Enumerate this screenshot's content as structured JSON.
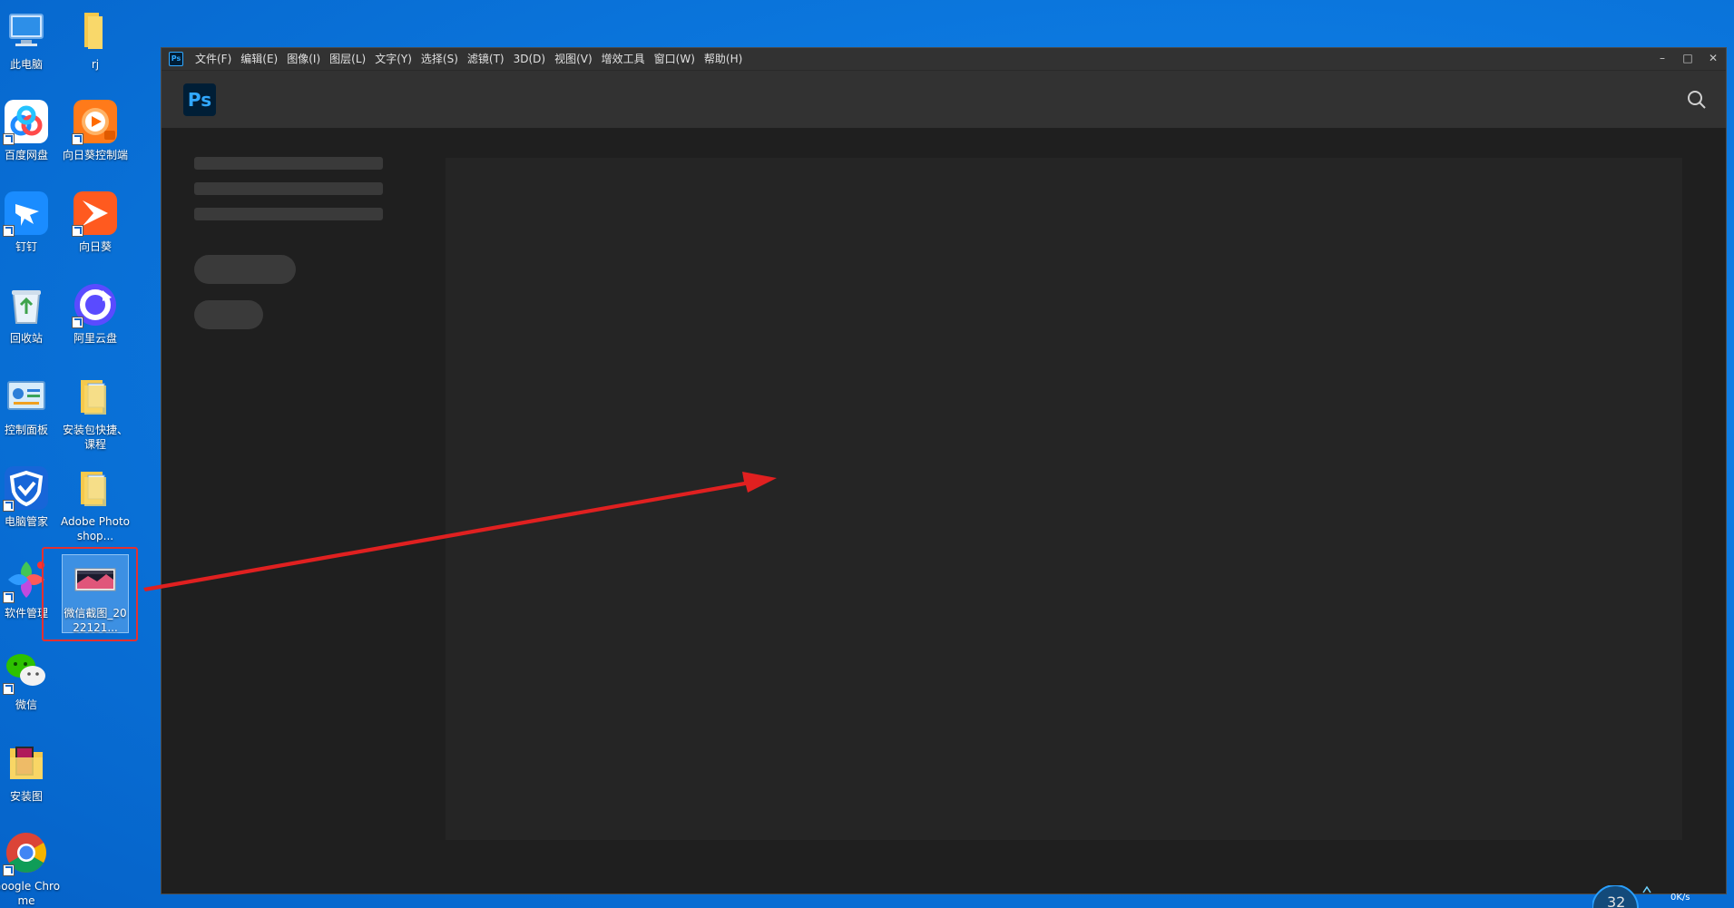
{
  "desktop": {
    "icons": [
      {
        "label": "此电脑"
      },
      {
        "label": "rj"
      },
      {
        "label": "百度网盘"
      },
      {
        "label": "向日葵控制端"
      },
      {
        "label": "钉钉"
      },
      {
        "label": "向日葵"
      },
      {
        "label": "回收站"
      },
      {
        "label": "阿里云盘"
      },
      {
        "label": "控制面板"
      },
      {
        "label": "安装包快捷、课程"
      },
      {
        "label": "电脑管家"
      },
      {
        "label": "Adobe Photoshop..."
      },
      {
        "label": "软件管理"
      },
      {
        "label": "微信截图_2022121..."
      },
      {
        "label": "微信"
      },
      {
        "label": "安装图"
      },
      {
        "label": "Google Chrome"
      }
    ]
  },
  "ps": {
    "logo_text": "Ps",
    "menu": [
      "文件(F)",
      "编辑(E)",
      "图像(I)",
      "图层(L)",
      "文字(Y)",
      "选择(S)",
      "滤镜(T)",
      "3D(D)",
      "视图(V)",
      "增效工具",
      "窗口(W)",
      "帮助(H)"
    ],
    "controls": {
      "minimize": "–",
      "maximize": "□",
      "close": "✕"
    }
  },
  "tray": {
    "speed_text": "0K/s",
    "gauge_text": "32"
  },
  "colors": {
    "desktop_bg": "#0c79e0",
    "ps_accent": "#31a8ff",
    "highlight": "#e53030",
    "arrow": "#e02020"
  }
}
